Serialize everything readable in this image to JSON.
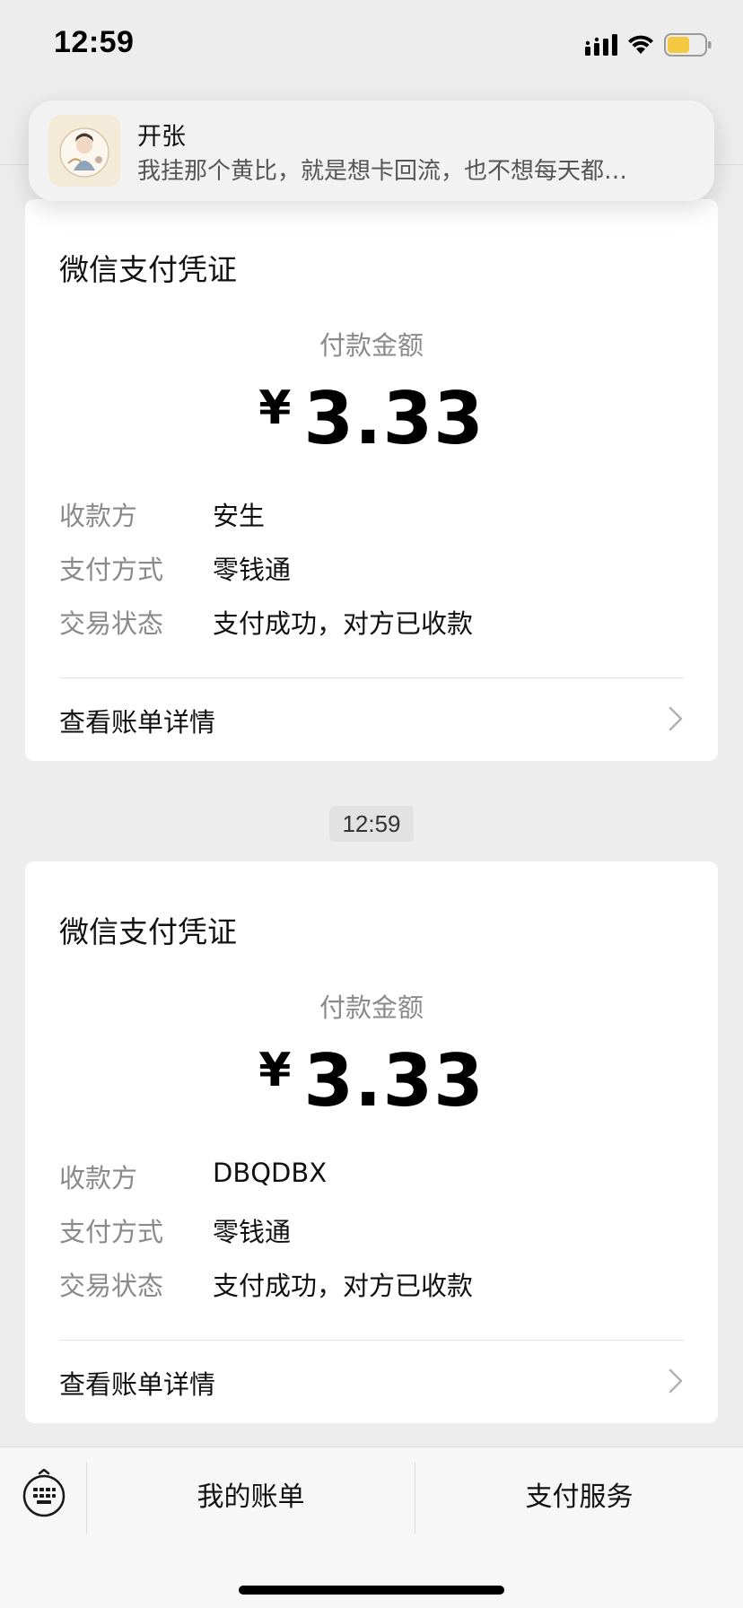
{
  "status_bar": {
    "time": "12:59"
  },
  "notification": {
    "title": "开张",
    "body": "我挂那个黄比，就是想卡回流，也不想每天都…"
  },
  "cards": [
    {
      "title": "微信支付凭证",
      "amount_label": "付款金额",
      "currency": "¥",
      "amount": "3.33",
      "rows": [
        {
          "key": "收款方",
          "value": "安生"
        },
        {
          "key": "支付方式",
          "value": "零钱通"
        },
        {
          "key": "交易状态",
          "value": "支付成功，对方已收款"
        }
      ],
      "link_label": "查看账单详情"
    },
    {
      "title": "微信支付凭证",
      "amount_label": "付款金额",
      "currency": "¥",
      "amount": "3.33",
      "rows": [
        {
          "key": "收款方",
          "value": "DBQDBX"
        },
        {
          "key": "支付方式",
          "value": "零钱通"
        },
        {
          "key": "交易状态",
          "value": "支付成功，对方已收款"
        }
      ],
      "link_label": "查看账单详情"
    }
  ],
  "timestamp": "12:59",
  "bottom_bar": {
    "keyboard_icon": "keyboard-icon",
    "items": [
      "我的账单",
      "支付服务"
    ]
  },
  "colors": {
    "background": "#ededed",
    "card": "#ffffff",
    "muted_text": "#8a8a8a",
    "battery": "#f5c842"
  }
}
